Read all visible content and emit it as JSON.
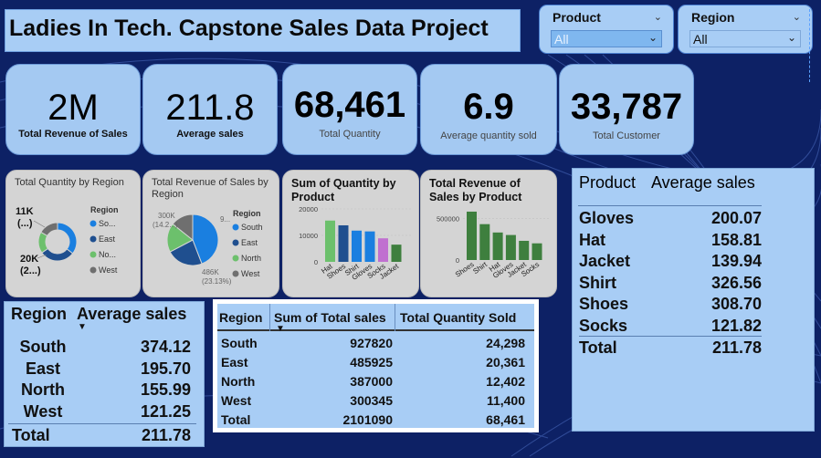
{
  "header": {
    "title": "Ladies In Tech. Capstone Sales Data Project"
  },
  "slicers": [
    {
      "label": "Product",
      "value": "All"
    },
    {
      "label": "Region",
      "value": "All"
    }
  ],
  "kpis": [
    {
      "value": "2M",
      "label": "Total Revenue of Sales"
    },
    {
      "value": "211.8",
      "label": "Average sales"
    },
    {
      "value": "68,461",
      "label": "Total Quantity"
    },
    {
      "value": "6.9",
      "label": "Average quantity sold"
    },
    {
      "value": "33,787",
      "label": "Total Customer"
    }
  ],
  "colors": {
    "south": "#1a7fe0",
    "east": "#1f4f8f",
    "north": "#6cc06c",
    "west": "#6f6f6f",
    "green_bar": "#3e7f3e"
  },
  "chart_data": [
    {
      "type": "pie",
      "title": "Total Quantity by Region",
      "legend_title": "Region",
      "legend_labels": [
        "So...",
        "East",
        "No...",
        "West"
      ],
      "data_labels": [
        "11K",
        "(...)",
        "20K",
        "(2...)"
      ],
      "categories": [
        "South",
        "East",
        "North",
        "West"
      ],
      "values": [
        24298,
        20361,
        12402,
        11400
      ],
      "donut": true
    },
    {
      "type": "pie",
      "title": "Total Revenue of Sales by Region",
      "legend_title": "Region",
      "legend_labels": [
        "South",
        "East",
        "North",
        "West"
      ],
      "data_labels": [
        "300K",
        "(14.2...)",
        "9...",
        "486K",
        "(23.13%)"
      ],
      "categories": [
        "South",
        "East",
        "North",
        "West"
      ],
      "values": [
        927820,
        485925,
        387000,
        300345
      ]
    },
    {
      "type": "bar",
      "title": "Sum of Quantity by Product",
      "categories": [
        "Hat",
        "Shoes",
        "Shirt",
        "Gloves",
        "Socks",
        "Jacket"
      ],
      "values": [
        15600,
        13800,
        11800,
        11500,
        8900,
        6500
      ],
      "colors": [
        "#6cc06c",
        "#1f4f8f",
        "#1a7fe0",
        "#1a7fe0",
        "#c070d0",
        "#3e7f3e"
      ],
      "ticks": [
        "0",
        "10000",
        "20000"
      ],
      "ylim": [
        0,
        20000
      ]
    },
    {
      "type": "bar",
      "title": "Total Revenue of Sales by Product",
      "categories": [
        "Shoes",
        "Shirt",
        "Hat",
        "Gloves",
        "Jacket",
        "Socks"
      ],
      "values": [
        580000,
        430000,
        330000,
        300000,
        230000,
        200000
      ],
      "ticks": [
        "0",
        "500000"
      ],
      "ylim": [
        0,
        700000
      ]
    }
  ],
  "product_table": {
    "headers": [
      "Product",
      "Average sales"
    ],
    "rows": [
      [
        "Gloves",
        "200.07"
      ],
      [
        "Hat",
        "158.81"
      ],
      [
        "Jacket",
        "139.94"
      ],
      [
        "Shirt",
        "326.56"
      ],
      [
        "Shoes",
        "308.70"
      ],
      [
        "Socks",
        "121.82"
      ]
    ],
    "total": [
      "Total",
      "211.78"
    ]
  },
  "region_table": {
    "headers": [
      "Region",
      "Average sales"
    ],
    "rows": [
      [
        "South",
        "374.12"
      ],
      [
        "East",
        "195.70"
      ],
      [
        "North",
        "155.99"
      ],
      [
        "West",
        "121.25"
      ]
    ],
    "total": [
      "Total",
      "211.78"
    ]
  },
  "region_sales_table": {
    "headers": [
      "Region",
      "Sum of Total sales",
      "Total Quantity Sold"
    ],
    "rows": [
      [
        "South",
        "927820",
        "24,298"
      ],
      [
        "East",
        "485925",
        "20,361"
      ],
      [
        "North",
        "387000",
        "12,402"
      ],
      [
        "West",
        "300345",
        "11,400"
      ]
    ],
    "total": [
      "Total",
      "2101090",
      "68,461"
    ]
  }
}
